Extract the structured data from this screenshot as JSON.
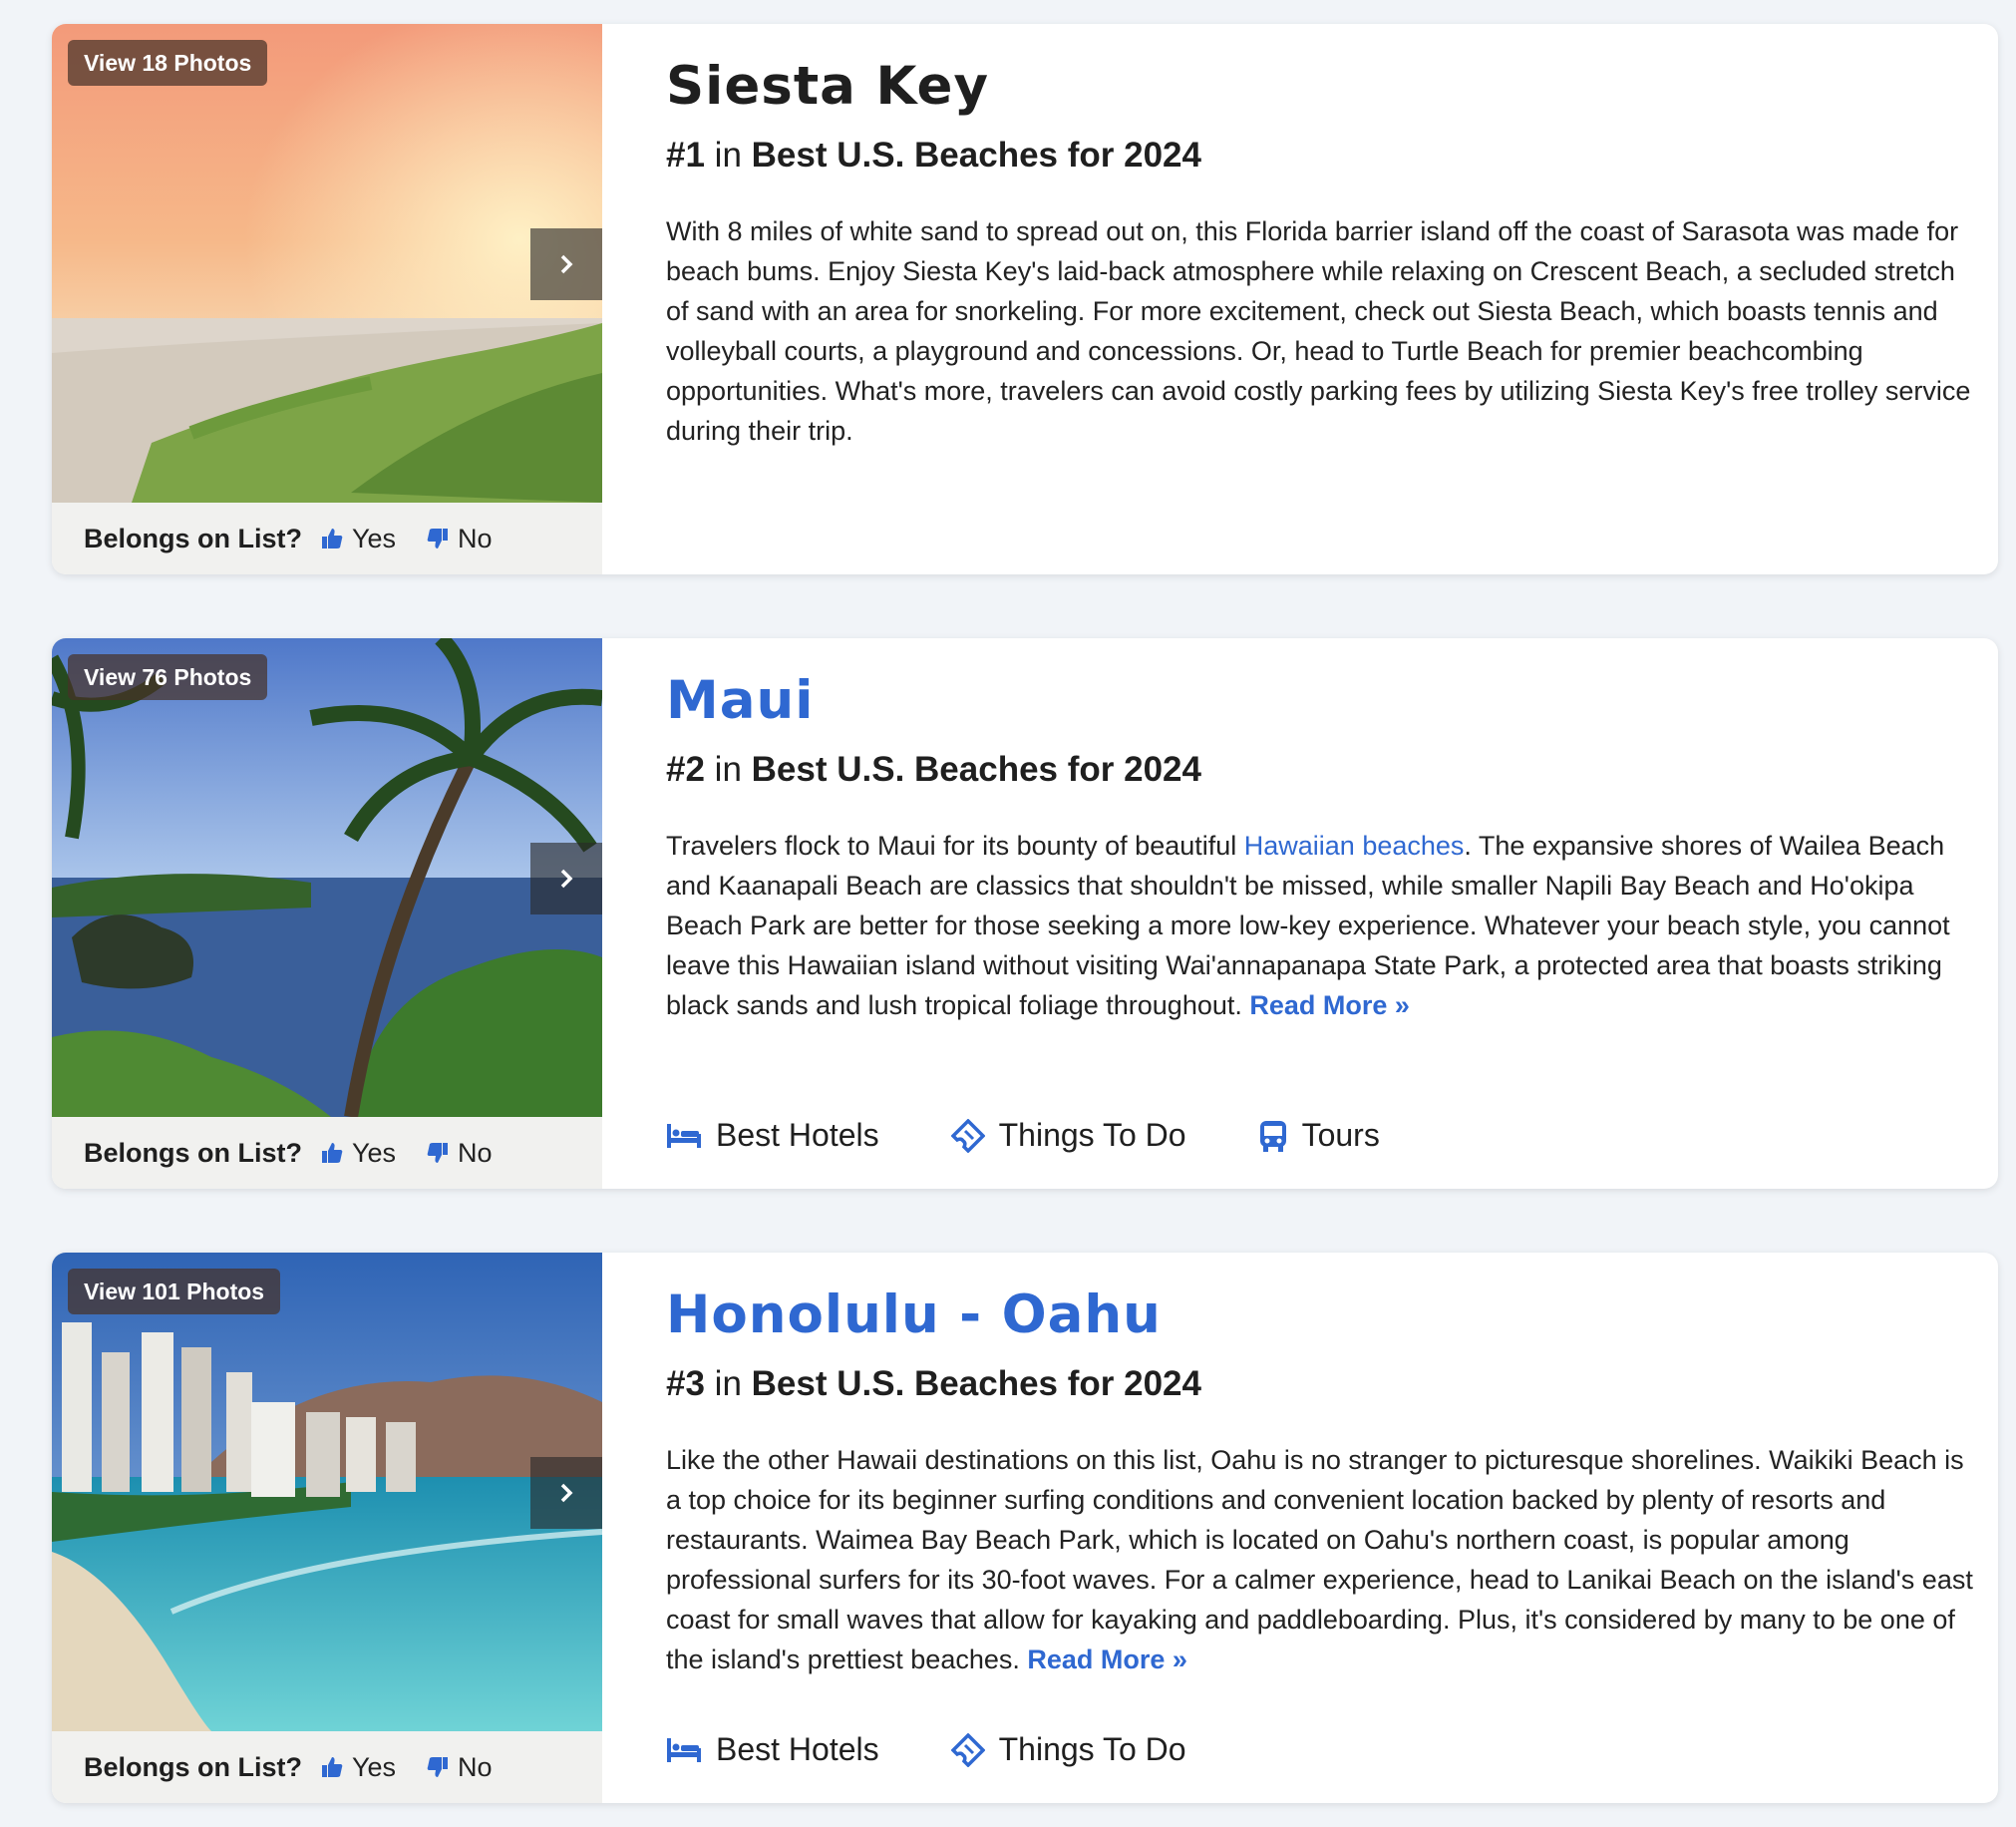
{
  "listings": [
    {
      "title": "Siesta Key",
      "title_is_link": false,
      "rank": "#1",
      "rank_in": "in",
      "list_name": "Best U.S. Beaches for 2024",
      "photos_label": "View 18 Photos",
      "desc_before": "With 8 miles of white sand to spread out on, this Florida barrier island off the coast of Sarasota was made for beach bums. Enjoy Siesta Key's laid-back atmosphere while relaxing on Crescent Beach, a secluded stretch of sand with an area for snorkeling. For more excitement, check out Siesta Beach, which boasts tennis and volleyball courts, a playground and concessions. Or, head to Turtle Beach for premier beachcombing opportunities. What's more, travelers can avoid costly parking fees by utilizing Siesta Key's free trolley service during their trip.",
      "desc_link": "",
      "desc_after": "",
      "read_more": "",
      "vote_label": "Belongs on List?",
      "vote_yes": "Yes",
      "vote_no": "No",
      "actions": []
    },
    {
      "title": "Maui",
      "title_is_link": true,
      "rank": "#2",
      "rank_in": "in",
      "list_name": "Best U.S. Beaches for 2024",
      "photos_label": "View 76 Photos",
      "desc_before": "Travelers flock to Maui for its bounty of beautiful ",
      "desc_link": "Hawaiian beaches",
      "desc_after": ". The expansive shores of Wailea Beach and Kaanapali Beach are classics that shouldn't be missed, while smaller Napili Bay Beach and Ho'okipa Beach Park are better for those seeking a more low-key experience. Whatever your beach style, you cannot leave this Hawaiian island without visiting Wai'annapanapa State Park, a protected area that boasts striking black sands and lush tropical foliage throughout. ",
      "read_more": "Read More »",
      "vote_label": "Belongs on List?",
      "vote_yes": "Yes",
      "vote_no": "No",
      "actions": [
        {
          "label": "Best Hotels",
          "icon": "bed-icon"
        },
        {
          "label": "Things To Do",
          "icon": "ticket-icon"
        },
        {
          "label": "Tours",
          "icon": "bus-icon"
        }
      ]
    },
    {
      "title": "Honolulu - Oahu",
      "title_is_link": true,
      "rank": "#3",
      "rank_in": "in",
      "list_name": "Best U.S. Beaches for 2024",
      "photos_label": "View 101 Photos",
      "desc_before": "Like the other Hawaii destinations on this list, Oahu is no stranger to picturesque shorelines. Waikiki Beach is a top choice for its beginner surfing conditions and convenient location backed by plenty of resorts and restaurants. Waimea Bay Beach Park, which is located on Oahu's northern coast, is popular among professional surfers for its 30-foot waves. For a calmer experience, head to Lanikai Beach on the island's east coast for small waves that allow for kayaking and paddleboarding. Plus, it's considered by many to be one of the island's prettiest beaches. ",
      "desc_link": "",
      "desc_after": "",
      "read_more": "Read More »",
      "vote_label": "Belongs on List?",
      "vote_yes": "Yes",
      "vote_no": "No",
      "actions": [
        {
          "label": "Best Hotels",
          "icon": "bed-icon"
        },
        {
          "label": "Things To Do",
          "icon": "ticket-icon"
        }
      ]
    }
  ],
  "colors": {
    "link": "#2f68d1",
    "text": "#1f1f1f",
    "background": "#f1f4f8"
  }
}
